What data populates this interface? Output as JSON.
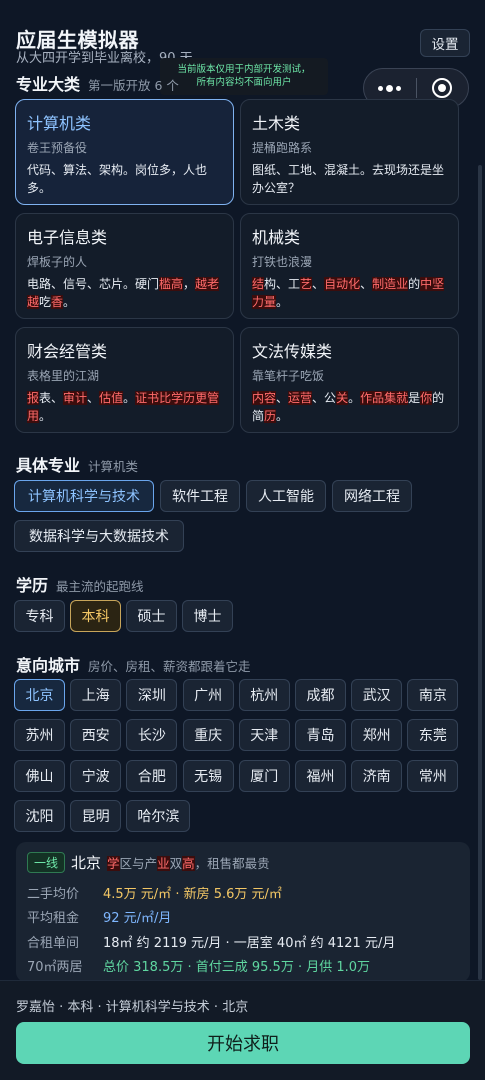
{
  "header": {
    "title": "应届生模拟器",
    "subtitle": "从大四开学到毕业离校，90 天",
    "settings_label": "设置",
    "notice_line1": "当前版本仅用于内部开发测试，",
    "notice_line2": "所有内容均不面向用户"
  },
  "capsule": {
    "more_icon": "more-dots-icon",
    "close_icon": "target-icon"
  },
  "major_category": {
    "heading": "专业大类",
    "sub": "第一版开放 6 个",
    "cards": [
      {
        "title": "计算机类",
        "sub": "卷王预备役",
        "desc": "代码、算法、架构。岗位多，人也多。",
        "selected": true
      },
      {
        "title": "土木类",
        "sub": "提桶跑路系",
        "desc": "图纸、工地、混凝土。去现场还是坐办公室？"
      },
      {
        "title": "电子信息类",
        "sub": "焊板子的人",
        "desc_parts": [
          "电路、信号、芯片。硬门",
          "槛高",
          "，",
          "越老越",
          "吃",
          "香",
          "。"
        ]
      },
      {
        "title": "机械类",
        "sub": "打铁也浪漫",
        "desc_parts": [
          "结",
          "构、工",
          "艺",
          "、",
          "自动化",
          "、",
          "制造业",
          "的",
          "中坚力量",
          "。"
        ]
      },
      {
        "title": "财会经管类",
        "sub": "表格里的江湖",
        "desc_parts": [
          "报",
          "表、",
          "审计",
          "、",
          "估值",
          "。",
          "证书比学历更管用",
          "。"
        ]
      },
      {
        "title": "文法传媒类",
        "sub": "靠笔杆子吃饭",
        "desc_parts": [
          "内容",
          "、",
          "运营",
          "、公",
          "关",
          "。",
          "作品集就",
          "是",
          "你",
          "的简",
          "历",
          "。"
        ]
      }
    ]
  },
  "specific_major": {
    "heading": "具体专业",
    "sub": "计算机类",
    "options": [
      "计算机科学与技术",
      "软件工程",
      "人工智能",
      "网络工程",
      "数据科学与大数据技术"
    ],
    "selected": "计算机科学与技术"
  },
  "education": {
    "heading": "学历",
    "sub": "最主流的起跑线",
    "options": [
      "专科",
      "本科",
      "硕士",
      "博士"
    ],
    "selected": "本科"
  },
  "city": {
    "heading": "意向城市",
    "sub": "房价、房租、薪资都跟着它走",
    "options": [
      "北京",
      "上海",
      "深圳",
      "广州",
      "杭州",
      "成都",
      "武汉",
      "南京",
      "苏州",
      "西安",
      "长沙",
      "重庆",
      "天津",
      "青岛",
      "郑州",
      "东莞",
      "佛山",
      "宁波",
      "合肥",
      "无锡",
      "厦门",
      "福州",
      "济南",
      "常州",
      "沈阳",
      "昆明",
      "哈尔滨"
    ],
    "selected": "北京"
  },
  "city_info": {
    "tier": "一线",
    "city": "北京",
    "desc_parts": [
      "学",
      "区与产",
      "业",
      "双",
      "高",
      "，租售都最贵"
    ],
    "rows": [
      {
        "label": "二手均价",
        "value": "4.5万 元/㎡ · 新房 5.6万 元/㎡"
      },
      {
        "label": "平均租金",
        "value": "92 元/㎡/月"
      },
      {
        "label": "合租单间",
        "value": "18㎡ 约 2119 元/月 · 一居室 40㎡ 约 4121 元/月"
      },
      {
        "label": "70㎡两居",
        "value": "总价 318.5万 · 首付三成 95.5万 · 月供 1.0万"
      }
    ]
  },
  "footer": {
    "summary": "罗嘉怡 · 本科 · 计算机科学与技术 · 北京",
    "start_label": "开始求职"
  },
  "colors": {
    "accent": "#5dd6b5",
    "selected_blue": "#7fb2f0",
    "selected_gold": "#f3c765",
    "highlight_red": "#ff6b6b"
  }
}
